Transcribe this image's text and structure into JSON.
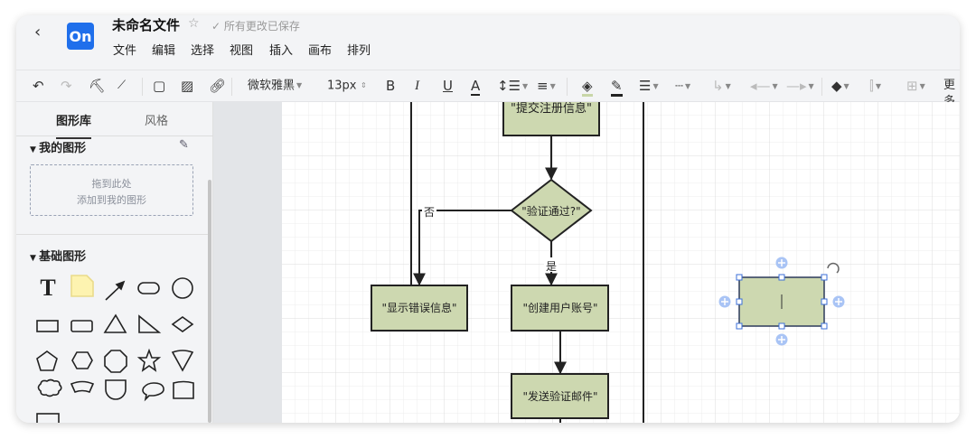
{
  "header": {
    "title": "未命名文件",
    "saved_status": "所有更改已保存",
    "logo": "On",
    "menu": [
      "文件",
      "编辑",
      "选择",
      "视图",
      "插入",
      "画布",
      "排列"
    ]
  },
  "toolbar": {
    "font": "微软雅黑",
    "font_size": "13px",
    "bold": "B",
    "italic": "I",
    "underline": "U",
    "font_color": "A",
    "more": "更多",
    "icons": [
      "undo-icon",
      "redo-icon",
      "format-painter-icon",
      "clear-format-icon",
      "shape-icon",
      "image-icon",
      "link-icon",
      "line-spacing-icon",
      "align-icon",
      "fill-color-icon",
      "line-color-icon",
      "line-weight-icon",
      "line-style-icon",
      "connector-icon",
      "arrow-start-icon",
      "arrow-end-icon",
      "layers-icon",
      "distribute-icon",
      "arrange-icon"
    ],
    "colors": {
      "fill": "#c8d6a8",
      "line": "#222222"
    }
  },
  "sidebar": {
    "tabs": [
      "图形库",
      "风格"
    ],
    "active_tab": "图形库",
    "my_shapes": {
      "title": "我的图形",
      "drop_line1": "拖到此处",
      "drop_line2": "添加到我的图形"
    },
    "basic_shapes": {
      "title": "基础图形",
      "text_glyph": "T"
    }
  },
  "diagram": {
    "fill_color": "#cdd8b0",
    "nodes": {
      "submit": "\"提交注册信息\"",
      "verify": "\"验证通过?\"",
      "error": "\"显示错误信息\"",
      "create": "\"创建用户账号\"",
      "email": "\"发送验证邮件\""
    },
    "labels": {
      "no": "否",
      "yes": "是"
    }
  }
}
